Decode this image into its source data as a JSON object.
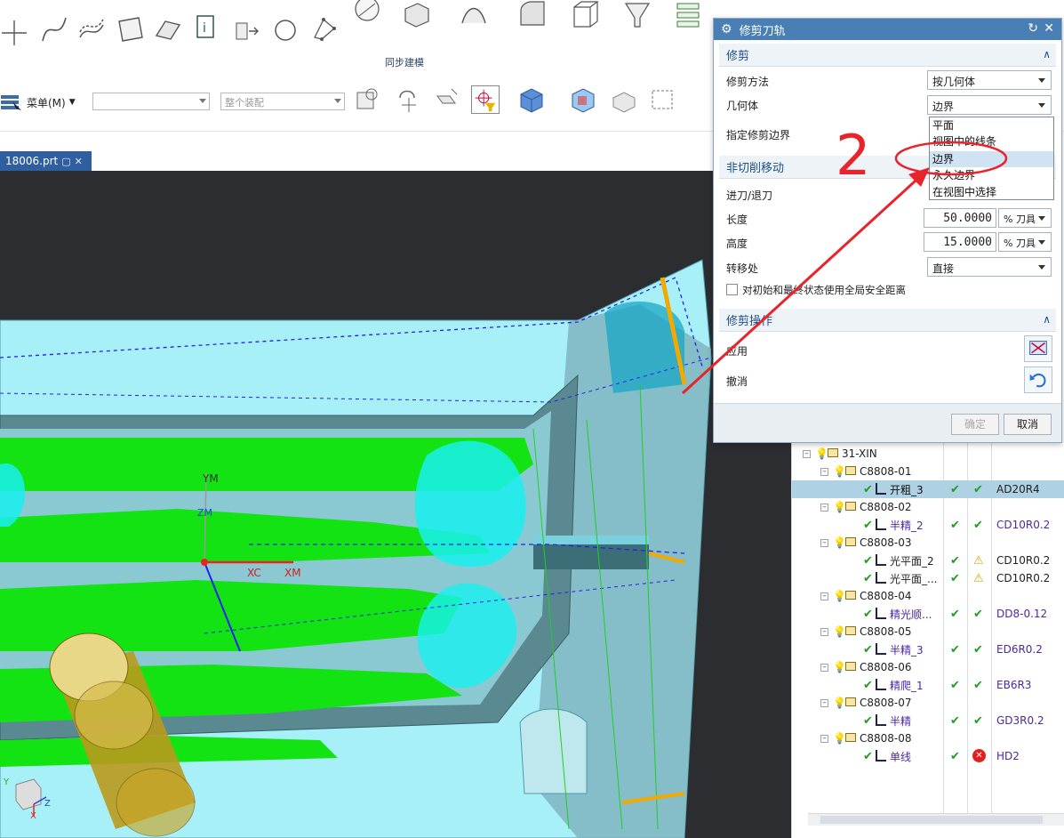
{
  "ribbon": {
    "group_label": "同步建模",
    "icons": [
      "sketch-point-icon",
      "curve-icon",
      "offset-curve-icon",
      "surface-icon",
      "face-icon",
      "info-icon",
      "extrude-icon",
      "circle-icon",
      "network-icon",
      "sphere-edit-icon",
      "block-edit-icon",
      "sweep-surface-icon",
      "fillet-icon",
      "box-icon",
      "funnel-icon",
      "layers-icon",
      "move-face-icon",
      "replace-face-icon",
      "delete-face-icon",
      "pull-face-icon"
    ]
  },
  "toolbar": {
    "menu_label": "菜单(M)",
    "filter_placeholder": "",
    "assembly_scope": "整个装配"
  },
  "tab": {
    "label": "18006.prt"
  },
  "viewport": {
    "labels": {
      "ym": "YM",
      "xm": "XM",
      "xc": "XC",
      "zm": "ZM",
      "z_axis": "Z",
      "x_axis": "X",
      "y_axis": "Y"
    }
  },
  "dialog": {
    "title": "修剪刀轨",
    "sections": {
      "trim": {
        "header": "修剪",
        "method_label": "修剪方法",
        "method_value": "按几何体",
        "geometry_label": "几何体",
        "geometry_value": "边界",
        "boundary_label": "指定修剪边界"
      },
      "noncut": {
        "header": "非切削移动",
        "engage_label": "进刀/退刀",
        "length_label": "长度",
        "length_value": "50.0000",
        "length_unit": "% 刀具",
        "height_label": "高度",
        "height_value": "15.0000",
        "height_unit": "% 刀具",
        "transfer_label": "转移处",
        "transfer_value": "直接",
        "checkbox_label": "对初始和最终状态使用全局安全距离"
      },
      "ops": {
        "header": "修剪操作",
        "apply_label": "应用",
        "undo_label": "撤消"
      }
    },
    "dropdown_options": [
      "平面",
      "视图中的线条",
      "边界",
      "永久边界",
      "在视图中选择"
    ],
    "highlighted_option": "边界",
    "buttons": {
      "ok": "确定",
      "cancel": "取消"
    }
  },
  "navigator": {
    "rows": [
      {
        "level": 1,
        "name": "31-XIN",
        "kind": "group",
        "tool": ""
      },
      {
        "level": 2,
        "name": "C8808-01",
        "kind": "group",
        "tool": ""
      },
      {
        "level": 3,
        "name": "开粗_3",
        "kind": "op",
        "status": "ok",
        "status2": "ok",
        "tool": "AD20R4",
        "selected": true
      },
      {
        "level": 2,
        "name": "C8808-02",
        "kind": "group",
        "tool": ""
      },
      {
        "level": 3,
        "name": "半精_2",
        "kind": "op",
        "status": "ok",
        "status2": "ok",
        "tool": "CD10R0.2"
      },
      {
        "level": 2,
        "name": "C8808-03",
        "kind": "group",
        "tool": ""
      },
      {
        "level": 3,
        "name": "光平面_2",
        "kind": "op-plain",
        "status": "ok",
        "status2": "warn",
        "tool": "CD10R0.2"
      },
      {
        "level": 3,
        "name": "光平面_...",
        "kind": "op-plain",
        "status": "ok",
        "status2": "warn",
        "tool": "CD10R0.2"
      },
      {
        "level": 2,
        "name": "C8808-04",
        "kind": "group",
        "tool": ""
      },
      {
        "level": 3,
        "name": "精光顺...",
        "kind": "op",
        "status": "ok",
        "status2": "ok",
        "tool": "DD8-0.12"
      },
      {
        "level": 2,
        "name": "C8808-05",
        "kind": "group",
        "tool": ""
      },
      {
        "level": 3,
        "name": "半精_3",
        "kind": "op",
        "status": "ok",
        "status2": "ok",
        "tool": "ED6R0.2"
      },
      {
        "level": 2,
        "name": "C8808-06",
        "kind": "group",
        "tool": ""
      },
      {
        "level": 3,
        "name": "精爬_1",
        "kind": "op",
        "status": "ok",
        "status2": "ok",
        "tool": "EB6R3"
      },
      {
        "level": 2,
        "name": "C8808-07",
        "kind": "group",
        "tool": ""
      },
      {
        "level": 3,
        "name": "半精",
        "kind": "op",
        "status": "ok",
        "status2": "ok",
        "tool": "GD3R0.2"
      },
      {
        "level": 2,
        "name": "C8808-08",
        "kind": "group",
        "tool": ""
      },
      {
        "level": 3,
        "name": "单线",
        "kind": "op",
        "status": "ok",
        "status2": "error",
        "tool": "HD2"
      }
    ]
  },
  "annotation": {
    "number": "2"
  },
  "colors": {
    "dialog_title": "#4a7fb5",
    "section_header_text": "#1d4f8a",
    "selected_row": "#aed1e3",
    "annotation_red": "#e8242a",
    "part_cyan": "#a8f0f8",
    "toolpath_green": "#13e313",
    "viewport_bg": "#2b2d30"
  }
}
